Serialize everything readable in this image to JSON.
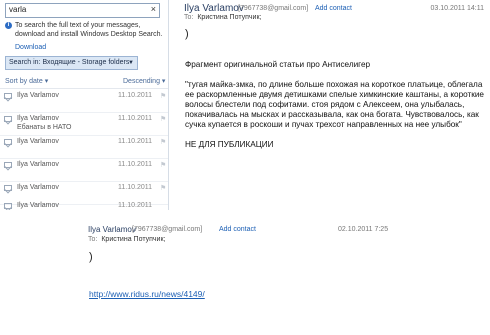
{
  "top": {
    "search": {
      "value": "varla",
      "clear_glyph": "×"
    },
    "info": {
      "icon": "info-icon",
      "text": "To search the full text of your messages, download and install Windows Desktop Search.",
      "link": "Download"
    },
    "search_in": "Search in: Входящие - Storage folders",
    "sort": {
      "by": "Sort by date",
      "order": "Descending"
    },
    "messages": [
      {
        "from": "Ilya Varlamov",
        "date": "11.10.2011",
        "subject": ""
      },
      {
        "from": "Ilya Varlamov",
        "date": "11.10.2011",
        "subject": "Ебанаты в НАТО"
      },
      {
        "from": "Ilya Varlamov",
        "date": "11.10.2011",
        "subject": ""
      },
      {
        "from": "Ilya Varlamov",
        "date": "11.10.2011",
        "subject": ""
      },
      {
        "from": "Ilya Varlamov",
        "date": "11.10.2011",
        "subject": ""
      },
      {
        "from": "Ilya Varlamov",
        "date": "11.10.2011",
        "subject": ""
      }
    ],
    "reading": {
      "sender": "Ilya Varlamov",
      "email": "[7967738@gmail.com]",
      "add_contact": "Add contact",
      "date": "03.10.2011 14:11",
      "to_label": "To:",
      "to": "Кристина Потупчик;",
      "subject": ")",
      "body": [
        "Фрагмент оригинальной статьи про Антиселигер",
        "\"тугая майка-змка, по длине больше похожая на короткое платьице, облегала ее раскормленные двумя детишками спелые химкинские каштаны, а короткие волосы блестели под софитами. стоя рядом с Алексеем, она улыбалась, покачивалась на мысках и рассказывала, как она богата. Чувствовалось, как сучка купается в роскоши и пучах трехсот направленных на нее улыбок\"",
        "НЕ ДЛЯ ПУБЛИКАЦИИ"
      ]
    }
  },
  "bottom": {
    "sender": "Ilya Varlamov",
    "email": "[7967738@gmail.com]",
    "add_contact": "Add contact",
    "date": "02.10.2011 7:25",
    "to_label": "To:",
    "to": "Кристина Потупчик;",
    "subject": ")",
    "link": "http://www.ridus.ru/news/4149/"
  }
}
